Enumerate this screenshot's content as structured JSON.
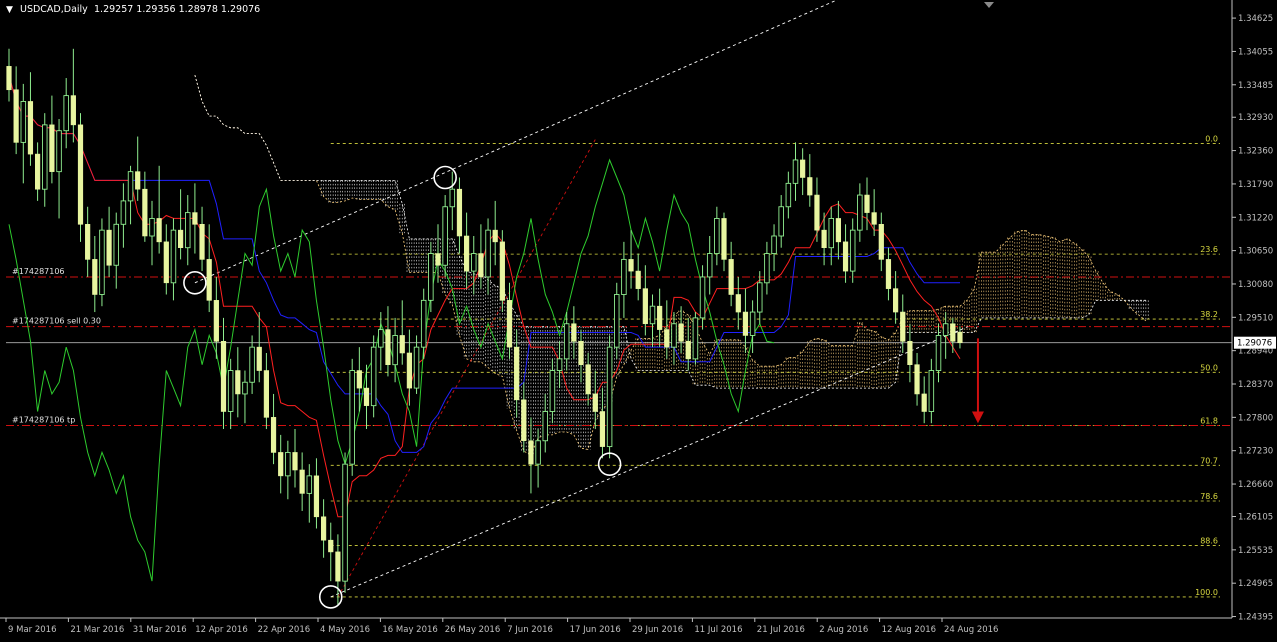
{
  "header": {
    "symbol_label": "USDCAD,Daily",
    "ohlc_label": "1.29257 1.29356 1.28978 1.29076"
  },
  "colors": {
    "background": "#000000",
    "axis": "#c0c0c0",
    "candle_fill": "#e8f5a0",
    "candle_stroke": "#90ee90",
    "tenkan": "#ff2020",
    "kijun": "#2020ff",
    "chikou": "#2ecc2e",
    "kumo_bull": "#ffd27f",
    "kumo_bear": "#ffffff",
    "fib_line": "#d8d840",
    "order_line": "#d01010",
    "channel_line": "#ffffff",
    "price_label_bg": "#ffffff",
    "arrow": "#d01010"
  },
  "chart_data": {
    "type": "candlestick",
    "symbol": "USDCAD",
    "timeframe": "Daily",
    "last_ohlc": {
      "open": 1.29257,
      "high": 1.29356,
      "low": 1.28978,
      "close": 1.29076
    },
    "current_price": "1.29076",
    "ylim": [
      1.2437,
      1.349
    ],
    "y_ticks": [
      "1.34625",
      "1.34055",
      "1.33485",
      "1.32930",
      "1.32360",
      "1.31790",
      "1.31220",
      "1.30650",
      "1.30080",
      "1.29510",
      "1.28940",
      "1.28370",
      "1.27800",
      "1.27230",
      "1.26660",
      "1.26105",
      "1.25535",
      "1.24965",
      "1.24395"
    ],
    "x_ticks": [
      "9 Mar 2016",
      "21 Mar 2016",
      "31 Mar 2016",
      "12 Apr 2016",
      "22 Apr 2016",
      "4 May 2016",
      "16 May 2016",
      "26 May 2016",
      "7 Jun 2016",
      "17 Jun 2016",
      "29 Jun 2016",
      "11 Jul 2016",
      "21 Jul 2016",
      "2 Aug 2016",
      "12 Aug 2016",
      "24 Aug 2016"
    ],
    "candles": [
      {
        "o": 1.338,
        "h": 1.341,
        "l": 1.332,
        "c": 1.334
      },
      {
        "o": 1.334,
        "h": 1.338,
        "l": 1.323,
        "c": 1.325
      },
      {
        "o": 1.325,
        "h": 1.335,
        "l": 1.318,
        "c": 1.332
      },
      {
        "o": 1.332,
        "h": 1.337,
        "l": 1.321,
        "c": 1.323
      },
      {
        "o": 1.323,
        "h": 1.325,
        "l": 1.315,
        "c": 1.317
      },
      {
        "o": 1.317,
        "h": 1.33,
        "l": 1.314,
        "c": 1.328
      },
      {
        "o": 1.328,
        "h": 1.333,
        "l": 1.318,
        "c": 1.32
      },
      {
        "o": 1.32,
        "h": 1.329,
        "l": 1.312,
        "c": 1.327
      },
      {
        "o": 1.327,
        "h": 1.336,
        "l": 1.324,
        "c": 1.333
      },
      {
        "o": 1.333,
        "h": 1.341,
        "l": 1.325,
        "c": 1.328
      },
      {
        "o": 1.328,
        "h": 1.33,
        "l": 1.308,
        "c": 1.311
      },
      {
        "o": 1.311,
        "h": 1.314,
        "l": 1.302,
        "c": 1.305
      },
      {
        "o": 1.305,
        "h": 1.309,
        "l": 1.296,
        "c": 1.299
      },
      {
        "o": 1.299,
        "h": 1.312,
        "l": 1.297,
        "c": 1.31
      },
      {
        "o": 1.31,
        "h": 1.314,
        "l": 1.302,
        "c": 1.304
      },
      {
        "o": 1.304,
        "h": 1.313,
        "l": 1.3,
        "c": 1.311
      },
      {
        "o": 1.311,
        "h": 1.318,
        "l": 1.307,
        "c": 1.315
      },
      {
        "o": 1.315,
        "h": 1.321,
        "l": 1.311,
        "c": 1.32
      },
      {
        "o": 1.32,
        "h": 1.326,
        "l": 1.315,
        "c": 1.317
      },
      {
        "o": 1.317,
        "h": 1.32,
        "l": 1.308,
        "c": 1.309
      },
      {
        "o": 1.309,
        "h": 1.315,
        "l": 1.304,
        "c": 1.312
      },
      {
        "o": 1.312,
        "h": 1.321,
        "l": 1.306,
        "c": 1.308
      },
      {
        "o": 1.308,
        "h": 1.311,
        "l": 1.299,
        "c": 1.301
      },
      {
        "o": 1.301,
        "h": 1.312,
        "l": 1.298,
        "c": 1.31
      },
      {
        "o": 1.31,
        "h": 1.317,
        "l": 1.305,
        "c": 1.307
      },
      {
        "o": 1.307,
        "h": 1.316,
        "l": 1.304,
        "c": 1.313
      },
      {
        "o": 1.313,
        "h": 1.318,
        "l": 1.306,
        "c": 1.311
      },
      {
        "o": 1.311,
        "h": 1.314,
        "l": 1.303,
        "c": 1.305
      },
      {
        "o": 1.305,
        "h": 1.311,
        "l": 1.296,
        "c": 1.298
      },
      {
        "o": 1.298,
        "h": 1.302,
        "l": 1.288,
        "c": 1.291
      },
      {
        "o": 1.291,
        "h": 1.295,
        "l": 1.276,
        "c": 1.279
      },
      {
        "o": 1.279,
        "h": 1.288,
        "l": 1.276,
        "c": 1.286
      },
      {
        "o": 1.286,
        "h": 1.29,
        "l": 1.278,
        "c": 1.282
      },
      {
        "o": 1.282,
        "h": 1.286,
        "l": 1.277,
        "c": 1.284
      },
      {
        "o": 1.284,
        "h": 1.292,
        "l": 1.282,
        "c": 1.29
      },
      {
        "o": 1.29,
        "h": 1.296,
        "l": 1.284,
        "c": 1.286
      },
      {
        "o": 1.286,
        "h": 1.289,
        "l": 1.276,
        "c": 1.278
      },
      {
        "o": 1.278,
        "h": 1.282,
        "l": 1.27,
        "c": 1.272
      },
      {
        "o": 1.272,
        "h": 1.275,
        "l": 1.265,
        "c": 1.268
      },
      {
        "o": 1.268,
        "h": 1.274,
        "l": 1.264,
        "c": 1.272
      },
      {
        "o": 1.272,
        "h": 1.276,
        "l": 1.266,
        "c": 1.269
      },
      {
        "o": 1.269,
        "h": 1.272,
        "l": 1.262,
        "c": 1.265
      },
      {
        "o": 1.265,
        "h": 1.27,
        "l": 1.26,
        "c": 1.268
      },
      {
        "o": 1.268,
        "h": 1.271,
        "l": 1.259,
        "c": 1.261
      },
      {
        "o": 1.261,
        "h": 1.264,
        "l": 1.254,
        "c": 1.257
      },
      {
        "o": 1.257,
        "h": 1.26,
        "l": 1.25,
        "c": 1.255
      },
      {
        "o": 1.255,
        "h": 1.258,
        "l": 1.246,
        "c": 1.25
      },
      {
        "o": 1.25,
        "h": 1.272,
        "l": 1.248,
        "c": 1.27
      },
      {
        "o": 1.27,
        "h": 1.288,
        "l": 1.268,
        "c": 1.286
      },
      {
        "o": 1.286,
        "h": 1.29,
        "l": 1.279,
        "c": 1.283
      },
      {
        "o": 1.283,
        "h": 1.287,
        "l": 1.276,
        "c": 1.28
      },
      {
        "o": 1.28,
        "h": 1.292,
        "l": 1.278,
        "c": 1.29
      },
      {
        "o": 1.29,
        "h": 1.296,
        "l": 1.286,
        "c": 1.293
      },
      {
        "o": 1.293,
        "h": 1.297,
        "l": 1.285,
        "c": 1.287
      },
      {
        "o": 1.287,
        "h": 1.295,
        "l": 1.284,
        "c": 1.292
      },
      {
        "o": 1.292,
        "h": 1.298,
        "l": 1.287,
        "c": 1.289
      },
      {
        "o": 1.289,
        "h": 1.293,
        "l": 1.28,
        "c": 1.283
      },
      {
        "o": 1.283,
        "h": 1.292,
        "l": 1.282,
        "c": 1.29
      },
      {
        "o": 1.29,
        "h": 1.3,
        "l": 1.288,
        "c": 1.298
      },
      {
        "o": 1.298,
        "h": 1.308,
        "l": 1.296,
        "c": 1.306
      },
      {
        "o": 1.306,
        "h": 1.311,
        "l": 1.301,
        "c": 1.304
      },
      {
        "o": 1.304,
        "h": 1.316,
        "l": 1.302,
        "c": 1.314
      },
      {
        "o": 1.314,
        "h": 1.32,
        "l": 1.31,
        "c": 1.317
      },
      {
        "o": 1.317,
        "h": 1.319,
        "l": 1.306,
        "c": 1.309
      },
      {
        "o": 1.309,
        "h": 1.313,
        "l": 1.3,
        "c": 1.303
      },
      {
        "o": 1.303,
        "h": 1.309,
        "l": 1.299,
        "c": 1.306
      },
      {
        "o": 1.306,
        "h": 1.311,
        "l": 1.3,
        "c": 1.302
      },
      {
        "o": 1.302,
        "h": 1.312,
        "l": 1.299,
        "c": 1.31
      },
      {
        "o": 1.31,
        "h": 1.315,
        "l": 1.304,
        "c": 1.308
      },
      {
        "o": 1.308,
        "h": 1.31,
        "l": 1.296,
        "c": 1.298
      },
      {
        "o": 1.298,
        "h": 1.301,
        "l": 1.288,
        "c": 1.29
      },
      {
        "o": 1.29,
        "h": 1.293,
        "l": 1.278,
        "c": 1.281
      },
      {
        "o": 1.281,
        "h": 1.284,
        "l": 1.272,
        "c": 1.274
      },
      {
        "o": 1.274,
        "h": 1.278,
        "l": 1.265,
        "c": 1.27
      },
      {
        "o": 1.27,
        "h": 1.276,
        "l": 1.266,
        "c": 1.274
      },
      {
        "o": 1.274,
        "h": 1.282,
        "l": 1.272,
        "c": 1.279
      },
      {
        "o": 1.279,
        "h": 1.288,
        "l": 1.277,
        "c": 1.286
      },
      {
        "o": 1.286,
        "h": 1.291,
        "l": 1.283,
        "c": 1.288
      },
      {
        "o": 1.288,
        "h": 1.296,
        "l": 1.286,
        "c": 1.294
      },
      {
        "o": 1.294,
        "h": 1.297,
        "l": 1.288,
        "c": 1.291
      },
      {
        "o": 1.291,
        "h": 1.293,
        "l": 1.284,
        "c": 1.287
      },
      {
        "o": 1.287,
        "h": 1.289,
        "l": 1.28,
        "c": 1.282
      },
      {
        "o": 1.282,
        "h": 1.286,
        "l": 1.276,
        "c": 1.279
      },
      {
        "o": 1.279,
        "h": 1.283,
        "l": 1.271,
        "c": 1.273
      },
      {
        "o": 1.273,
        "h": 1.292,
        "l": 1.271,
        "c": 1.29
      },
      {
        "o": 1.29,
        "h": 1.301,
        "l": 1.288,
        "c": 1.299
      },
      {
        "o": 1.299,
        "h": 1.308,
        "l": 1.295,
        "c": 1.305
      },
      {
        "o": 1.305,
        "h": 1.31,
        "l": 1.3,
        "c": 1.303
      },
      {
        "o": 1.303,
        "h": 1.306,
        "l": 1.298,
        "c": 1.3
      },
      {
        "o": 1.3,
        "h": 1.304,
        "l": 1.292,
        "c": 1.294
      },
      {
        "o": 1.294,
        "h": 1.299,
        "l": 1.29,
        "c": 1.297
      },
      {
        "o": 1.297,
        "h": 1.3,
        "l": 1.29,
        "c": 1.293
      },
      {
        "o": 1.293,
        "h": 1.298,
        "l": 1.288,
        "c": 1.29
      },
      {
        "o": 1.29,
        "h": 1.296,
        "l": 1.287,
        "c": 1.294
      },
      {
        "o": 1.294,
        "h": 1.297,
        "l": 1.289,
        "c": 1.291
      },
      {
        "o": 1.291,
        "h": 1.295,
        "l": 1.286,
        "c": 1.288
      },
      {
        "o": 1.288,
        "h": 1.296,
        "l": 1.287,
        "c": 1.295
      },
      {
        "o": 1.295,
        "h": 1.304,
        "l": 1.293,
        "c": 1.302
      },
      {
        "o": 1.302,
        "h": 1.309,
        "l": 1.299,
        "c": 1.306
      },
      {
        "o": 1.306,
        "h": 1.314,
        "l": 1.304,
        "c": 1.312
      },
      {
        "o": 1.312,
        "h": 1.313,
        "l": 1.303,
        "c": 1.305
      },
      {
        "o": 1.305,
        "h": 1.308,
        "l": 1.297,
        "c": 1.299
      },
      {
        "o": 1.299,
        "h": 1.302,
        "l": 1.293,
        "c": 1.296
      },
      {
        "o": 1.296,
        "h": 1.3,
        "l": 1.289,
        "c": 1.292
      },
      {
        "o": 1.292,
        "h": 1.298,
        "l": 1.289,
        "c": 1.296
      },
      {
        "o": 1.296,
        "h": 1.303,
        "l": 1.294,
        "c": 1.301
      },
      {
        "o": 1.301,
        "h": 1.308,
        "l": 1.299,
        "c": 1.306
      },
      {
        "o": 1.306,
        "h": 1.311,
        "l": 1.303,
        "c": 1.309
      },
      {
        "o": 1.309,
        "h": 1.316,
        "l": 1.307,
        "c": 1.314
      },
      {
        "o": 1.314,
        "h": 1.32,
        "l": 1.312,
        "c": 1.318
      },
      {
        "o": 1.318,
        "h": 1.325,
        "l": 1.315,
        "c": 1.322
      },
      {
        "o": 1.322,
        "h": 1.324,
        "l": 1.316,
        "c": 1.319
      },
      {
        "o": 1.319,
        "h": 1.323,
        "l": 1.314,
        "c": 1.316
      },
      {
        "o": 1.316,
        "h": 1.319,
        "l": 1.308,
        "c": 1.31
      },
      {
        "o": 1.31,
        "h": 1.313,
        "l": 1.304,
        "c": 1.307
      },
      {
        "o": 1.307,
        "h": 1.314,
        "l": 1.304,
        "c": 1.312
      },
      {
        "o": 1.312,
        "h": 1.315,
        "l": 1.305,
        "c": 1.308
      },
      {
        "o": 1.308,
        "h": 1.311,
        "l": 1.301,
        "c": 1.303
      },
      {
        "o": 1.303,
        "h": 1.312,
        "l": 1.301,
        "c": 1.31
      },
      {
        "o": 1.31,
        "h": 1.318,
        "l": 1.308,
        "c": 1.316
      },
      {
        "o": 1.316,
        "h": 1.319,
        "l": 1.31,
        "c": 1.313
      },
      {
        "o": 1.313,
        "h": 1.317,
        "l": 1.309,
        "c": 1.311
      },
      {
        "o": 1.311,
        "h": 1.313,
        "l": 1.303,
        "c": 1.305
      },
      {
        "o": 1.305,
        "h": 1.307,
        "l": 1.298,
        "c": 1.3
      },
      {
        "o": 1.3,
        "h": 1.303,
        "l": 1.294,
        "c": 1.296
      },
      {
        "o": 1.296,
        "h": 1.299,
        "l": 1.289,
        "c": 1.291
      },
      {
        "o": 1.291,
        "h": 1.294,
        "l": 1.284,
        "c": 1.287
      },
      {
        "o": 1.287,
        "h": 1.289,
        "l": 1.28,
        "c": 1.282
      },
      {
        "o": 1.282,
        "h": 1.285,
        "l": 1.277,
        "c": 1.279
      },
      {
        "o": 1.279,
        "h": 1.288,
        "l": 1.277,
        "c": 1.286
      },
      {
        "o": 1.286,
        "h": 1.294,
        "l": 1.284,
        "c": 1.292
      },
      {
        "o": 1.292,
        "h": 1.296,
        "l": 1.288,
        "c": 1.294
      },
      {
        "o": 1.294,
        "h": 1.295,
        "l": 1.289,
        "c": 1.291
      },
      {
        "o": 1.29257,
        "h": 1.29356,
        "l": 1.28978,
        "c": 1.29076
      }
    ],
    "fibonacci": [
      {
        "level": "0.0",
        "price": 1.3248
      },
      {
        "level": "23.6",
        "price": 1.3059
      },
      {
        "level": "38.2",
        "price": 1.2948
      },
      {
        "level": "50.0",
        "price": 1.2857
      },
      {
        "level": "61.8",
        "price": 1.2766
      },
      {
        "level": "70.7",
        "price": 1.2698
      },
      {
        "level": "78.6",
        "price": 1.2637
      },
      {
        "level": "88.6",
        "price": 1.2561
      },
      {
        "level": "100.0",
        "price": 1.2473
      }
    ],
    "orders": [
      {
        "label": "#174287106",
        "price": 1.302
      },
      {
        "label": "#174287106 sell 0.30",
        "price": 1.2935
      },
      {
        "label": "#174287106 tp",
        "price": 1.2766
      }
    ]
  }
}
